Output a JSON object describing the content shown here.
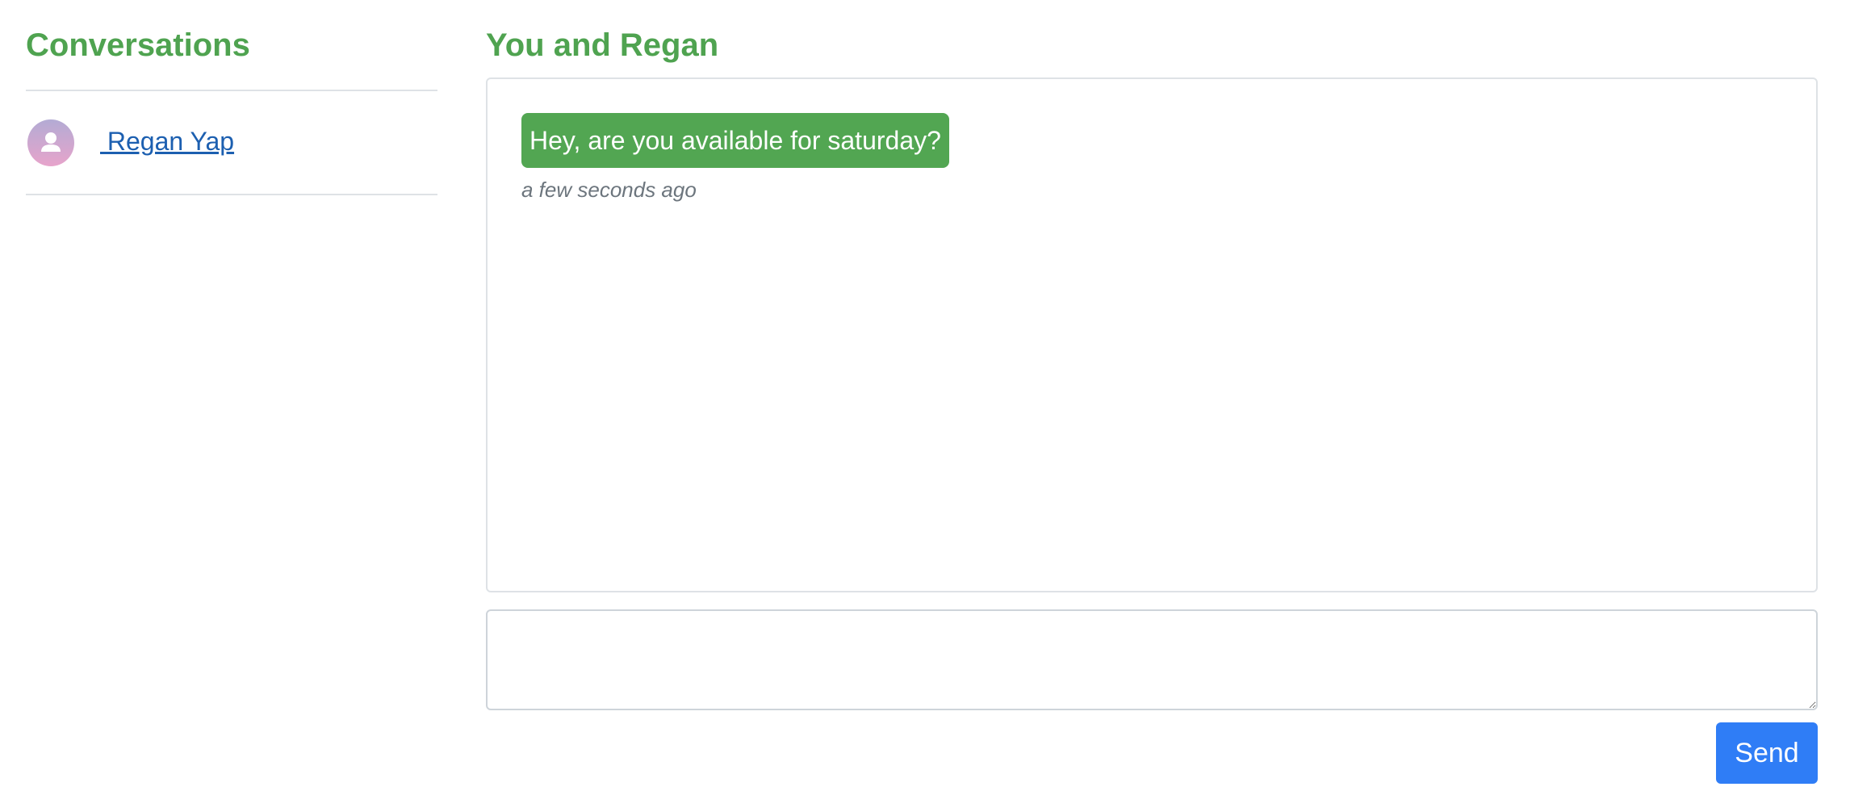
{
  "sidebar": {
    "title": "Conversations",
    "conversations": [
      {
        "name": " Regan Yap",
        "avatar_icon": "user-avatar-icon"
      }
    ]
  },
  "chat": {
    "title": "You and Regan",
    "messages": [
      {
        "text": "Hey, are you available for saturday?",
        "time": "a few seconds ago",
        "bubble_color": "#52a652"
      }
    ]
  },
  "composer": {
    "placeholder": "",
    "value": "",
    "send_label": "Send"
  },
  "colors": {
    "accent_green": "#4fa350",
    "link_blue": "#1c5fb0",
    "button_blue": "#2f7df6"
  }
}
